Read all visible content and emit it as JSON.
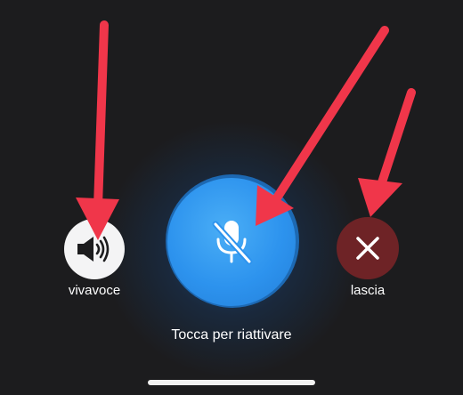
{
  "call_controls": {
    "speaker": {
      "label": "vivavoce",
      "icon": "speaker-icon"
    },
    "mute": {
      "icon": "mic-slash-icon",
      "state": "muted"
    },
    "leave": {
      "label": "lascia",
      "icon": "close-icon"
    }
  },
  "hint": {
    "text": "Tocca per riattivare"
  },
  "annotation": {
    "arrow_color": "#f0364a"
  },
  "colors": {
    "background": "#1c1c1e",
    "mute_button": "#2d93ee",
    "leave_button": "#6e2326",
    "speaker_button": "#f4f4f5"
  }
}
